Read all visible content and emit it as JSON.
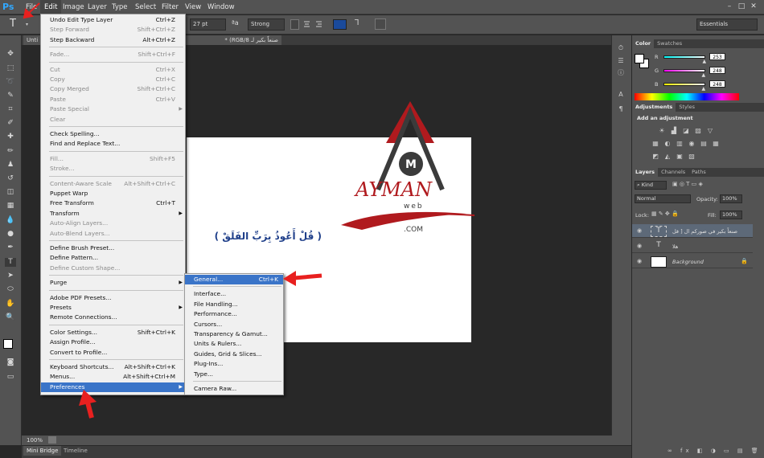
{
  "app": {
    "logo": "Ps"
  },
  "menubar": {
    "items": [
      "File",
      "Edit",
      "Image",
      "Layer",
      "Type",
      "Select",
      "Filter",
      "View",
      "Window"
    ],
    "active": "Edit"
  },
  "window_buttons": {
    "minimize": "–",
    "maximize": "□",
    "close": "✕"
  },
  "options": {
    "font_size": "27 pt",
    "aa_icon": "ªa",
    "antialias": "Strong",
    "workspace": "Essentials"
  },
  "document": {
    "tab_left": "Unti",
    "tab_title": "صنعاً بكير لـ RGB/8) *",
    "zoom": "100%",
    "arabic_text": "( قُلْ أَعُوذُ بِرَبِّ الفَلَقْ )",
    "logo": {
      "word": "AYMAN",
      "sub": "web",
      "dot": ".COM",
      "badge": "M"
    }
  },
  "bottom_tabs": [
    "Mini Bridge",
    "Timeline"
  ],
  "edit_menu": {
    "groups": [
      [
        {
          "label": "Undo Edit Type Layer",
          "shortcut": "Ctrl+Z",
          "enabled": true
        },
        {
          "label": "Step Forward",
          "shortcut": "Shift+Ctrl+Z",
          "enabled": false
        },
        {
          "label": "Step Backward",
          "shortcut": "Alt+Ctrl+Z",
          "enabled": true
        }
      ],
      [
        {
          "label": "Fade...",
          "shortcut": "Shift+Ctrl+F",
          "enabled": false
        }
      ],
      [
        {
          "label": "Cut",
          "shortcut": "Ctrl+X",
          "enabled": false
        },
        {
          "label": "Copy",
          "shortcut": "Ctrl+C",
          "enabled": false
        },
        {
          "label": "Copy Merged",
          "shortcut": "Shift+Ctrl+C",
          "enabled": false
        },
        {
          "label": "Paste",
          "shortcut": "Ctrl+V",
          "enabled": false
        },
        {
          "label": "Paste Special",
          "shortcut": "",
          "enabled": false,
          "submenu": true
        },
        {
          "label": "Clear",
          "shortcut": "",
          "enabled": false
        }
      ],
      [
        {
          "label": "Check Spelling...",
          "shortcut": "",
          "enabled": true
        },
        {
          "label": "Find and Replace Text...",
          "shortcut": "",
          "enabled": true
        }
      ],
      [
        {
          "label": "Fill...",
          "shortcut": "Shift+F5",
          "enabled": false
        },
        {
          "label": "Stroke...",
          "shortcut": "",
          "enabled": false
        }
      ],
      [
        {
          "label": "Content-Aware Scale",
          "shortcut": "Alt+Shift+Ctrl+C",
          "enabled": false
        },
        {
          "label": "Puppet Warp",
          "shortcut": "",
          "enabled": true
        },
        {
          "label": "Free Transform",
          "shortcut": "Ctrl+T",
          "enabled": true
        },
        {
          "label": "Transform",
          "shortcut": "",
          "enabled": true,
          "submenu": true
        },
        {
          "label": "Auto-Align Layers...",
          "shortcut": "",
          "enabled": false
        },
        {
          "label": "Auto-Blend Layers...",
          "shortcut": "",
          "enabled": false
        }
      ],
      [
        {
          "label": "Define Brush Preset...",
          "shortcut": "",
          "enabled": true
        },
        {
          "label": "Define Pattern...",
          "shortcut": "",
          "enabled": true
        },
        {
          "label": "Define Custom Shape...",
          "shortcut": "",
          "enabled": false
        }
      ],
      [
        {
          "label": "Purge",
          "shortcut": "",
          "enabled": true,
          "submenu": true
        }
      ],
      [
        {
          "label": "Adobe PDF Presets...",
          "shortcut": "",
          "enabled": true
        },
        {
          "label": "Presets",
          "shortcut": "",
          "enabled": true,
          "submenu": true
        },
        {
          "label": "Remote Connections...",
          "shortcut": "",
          "enabled": true
        }
      ],
      [
        {
          "label": "Color Settings...",
          "shortcut": "Shift+Ctrl+K",
          "enabled": true
        },
        {
          "label": "Assign Profile...",
          "shortcut": "",
          "enabled": true
        },
        {
          "label": "Convert to Profile...",
          "shortcut": "",
          "enabled": true
        }
      ],
      [
        {
          "label": "Keyboard Shortcuts...",
          "shortcut": "Alt+Shift+Ctrl+K",
          "enabled": true
        },
        {
          "label": "Menus...",
          "shortcut": "Alt+Shift+Ctrl+M",
          "enabled": true
        },
        {
          "label": "Preferences",
          "shortcut": "",
          "enabled": true,
          "submenu": true,
          "highlighted": true
        }
      ]
    ]
  },
  "prefs_menu": {
    "groups": [
      [
        {
          "label": "General...",
          "shortcut": "Ctrl+K",
          "highlighted": true
        }
      ],
      [
        {
          "label": "Interface...",
          "shortcut": ""
        },
        {
          "label": "File Handling...",
          "shortcut": ""
        },
        {
          "label": "Performance...",
          "shortcut": ""
        },
        {
          "label": "Cursors...",
          "shortcut": ""
        },
        {
          "label": "Transparency & Gamut...",
          "shortcut": ""
        },
        {
          "label": "Units & Rulers...",
          "shortcut": ""
        },
        {
          "label": "Guides, Grid & Slices...",
          "shortcut": ""
        },
        {
          "label": "Plug-Ins...",
          "shortcut": ""
        },
        {
          "label": "Type...",
          "shortcut": ""
        }
      ],
      [
        {
          "label": "Camera Raw...",
          "shortcut": ""
        }
      ]
    ]
  },
  "color_panel": {
    "tabs": [
      "Color",
      "Swatches"
    ],
    "channels": [
      {
        "name": "R",
        "value": "253",
        "fraction": 0.99
      },
      {
        "name": "G",
        "value": "248",
        "fraction": 0.97
      },
      {
        "name": "B",
        "value": "248",
        "fraction": 0.97
      }
    ]
  },
  "adjustments_panel": {
    "tabs": [
      "Adjustments",
      "Styles"
    ],
    "title": "Add an adjustment"
  },
  "layers_panel": {
    "tabs": [
      "Layers",
      "Channels",
      "Paths"
    ],
    "kind": "Kind",
    "blend": "Normal",
    "opacity_label": "Opacity:",
    "opacity": "100%",
    "lock_label": "Lock:",
    "fill_label": "Fill:",
    "fill": "100%",
    "layers": [
      {
        "name": "صنعاً بكير في صوركم ال [ قل",
        "type": "text",
        "selected": true
      },
      {
        "name": "هلا",
        "type": "text",
        "selected": false
      },
      {
        "name": "Background",
        "type": "image",
        "selected": false,
        "locked": true
      }
    ]
  },
  "colors": {
    "highlight": "#3a74c8",
    "annotation_arrow": "#e8201f",
    "logo_red": "#b01a1e",
    "logo_dark": "#3b3b3b"
  }
}
